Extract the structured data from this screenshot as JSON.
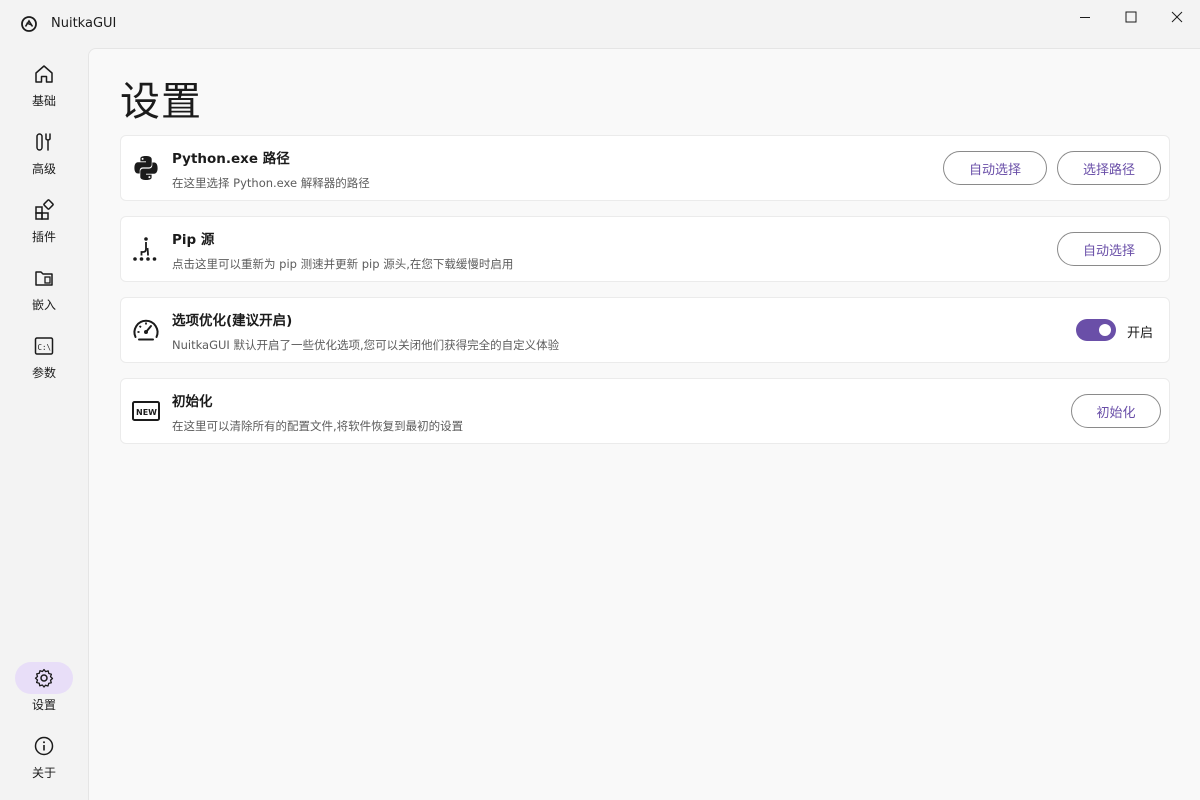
{
  "window": {
    "title": "NuitkaGUI"
  },
  "sidebar": {
    "items": [
      {
        "label": "基础",
        "icon": "home-icon"
      },
      {
        "label": "高级",
        "icon": "tools-icon"
      },
      {
        "label": "插件",
        "icon": "apps-add-icon"
      },
      {
        "label": "嵌入",
        "icon": "folder-embed-icon"
      },
      {
        "label": "参数",
        "icon": "command-prompt-icon"
      }
    ],
    "bottom_items": [
      {
        "label": "设置",
        "icon": "gear-icon",
        "active": true
      },
      {
        "label": "关于",
        "icon": "info-icon"
      }
    ]
  },
  "main": {
    "title": "设置",
    "cards": [
      {
        "title": "Python.exe 路径",
        "desc": "在这里选择 Python.exe 解释器的路径",
        "icon": "python-icon",
        "buttons": [
          "自动选择",
          "选择路径"
        ]
      },
      {
        "title": "Pip 源",
        "desc": "点击这里可以重新为 pip 测速并更新 pip 源头,在您下载缓慢时启用",
        "icon": "pip-branch-icon",
        "buttons": [
          "自动选择"
        ]
      },
      {
        "title": "选项优化(建议开启)",
        "desc": "NuitkaGUI 默认开启了一些优化选项,您可以关闭他们获得完全的自定义体验",
        "icon": "speedometer-icon",
        "toggle": {
          "on": true,
          "label": "开启"
        }
      },
      {
        "title": "初始化",
        "desc": "在这里可以清除所有的配置文件,将软件恢复到最初的设置",
        "icon": "new-badge-icon",
        "buttons": [
          "初始化"
        ]
      }
    ]
  },
  "colors": {
    "accent": "#6a4fa8",
    "active_nav_bg": "#e8def8"
  }
}
